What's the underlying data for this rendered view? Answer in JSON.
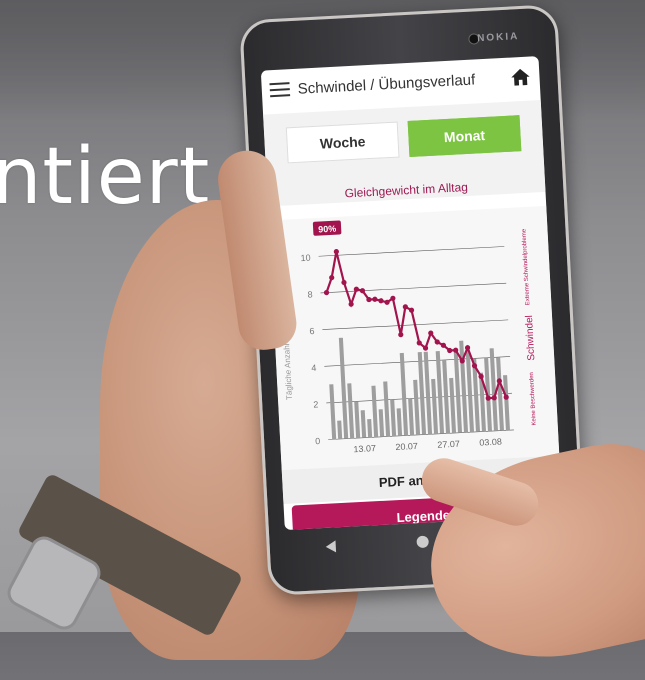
{
  "overlay": {
    "text": "ntiert"
  },
  "phone": {
    "brand": "NOKIA"
  },
  "app": {
    "title": "Schwindel / Übungsverlauf",
    "tabs": [
      {
        "label": "Woche",
        "active": false
      },
      {
        "label": "Monat",
        "active": true
      }
    ],
    "pdf_label": "PDF anzeigen",
    "legend_label": "Legende",
    "accent_color": "#b5195a",
    "active_tab_color": "#7cc442"
  },
  "chart_data": {
    "type": "line",
    "title": "Gleichgewicht im Alltag",
    "ylabel": "Tägliche Anzahl Übungseinheiten",
    "y2label": "Schwindel",
    "y2_top_label": "Extreme Schwindelprobleme",
    "y2_bottom_label": "Keine Beschwerden",
    "annotation": "90%",
    "ylim": [
      0,
      11
    ],
    "yticks": [
      0,
      2,
      4,
      6,
      8,
      10
    ],
    "xticks": [
      "13.07",
      "20.07",
      "27.07",
      "03.08"
    ],
    "bars": [
      3,
      1,
      5.5,
      3,
      2,
      1.5,
      1,
      2.8,
      1.5,
      3,
      2,
      1.5,
      4.5,
      2,
      3,
      4.5,
      4.5,
      3,
      4.5,
      4,
      3,
      4.5,
      5,
      4.5,
      4,
      3.2,
      4,
      4.5,
      4,
      3
    ],
    "line": [
      8,
      8.8,
      10.2,
      8.5,
      7.3,
      8.1,
      8,
      7.5,
      7.5,
      7.4,
      7.3,
      7.5,
      5.5,
      7,
      6.8,
      5,
      4.7,
      5.5,
      5,
      4.8,
      4.5,
      4.5,
      3.9,
      4.6,
      3.6,
      3,
      1.8,
      1.8,
      2.7,
      1.8
    ],
    "line_color": "#a2144d",
    "bar_color": "#9e9e9e"
  }
}
